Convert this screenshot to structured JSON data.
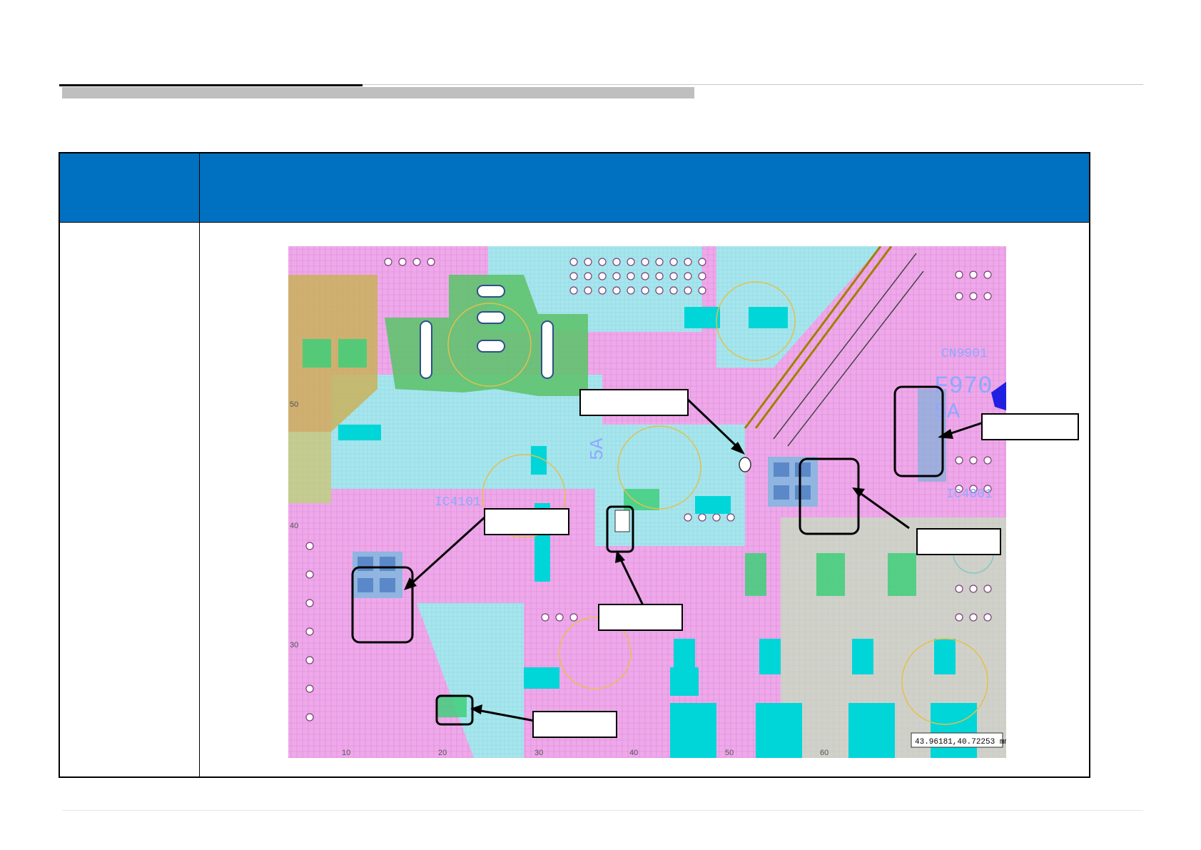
{
  "page": {
    "header_title": "",
    "footer_text": ""
  },
  "table": {
    "header": {
      "col1": "",
      "col2": ""
    },
    "row1": {
      "col1": ""
    }
  },
  "pcb": {
    "coordinate_readout": "43.96181,40.72253 mm",
    "silkscreen": {
      "cn": "CN9901",
      "ic_left": "IC4101",
      "ic_right": "IC4001",
      "ref_big": "F970",
      "ref_sub": "5A",
      "ref_mid": "5A"
    },
    "axis_ticks": {
      "left": [
        "50",
        "40",
        "30"
      ],
      "bottom": [
        "10",
        "20",
        "30",
        "40",
        "50",
        "60"
      ]
    },
    "callouts": [
      {
        "id": "top-center",
        "text": ""
      },
      {
        "id": "right-top",
        "text": ""
      },
      {
        "id": "right-mid",
        "text": ""
      },
      {
        "id": "left-mid",
        "text": ""
      },
      {
        "id": "center",
        "text": ""
      },
      {
        "id": "bottom-left",
        "text": ""
      }
    ]
  },
  "colors": {
    "header_blue": "#0070c0",
    "board_pink": "#f1a6ee",
    "copper_cyan": "#9ee7ef",
    "pad_cyan": "#00d5d8",
    "olive": "#c8b45a",
    "green": "#5fc66e"
  }
}
